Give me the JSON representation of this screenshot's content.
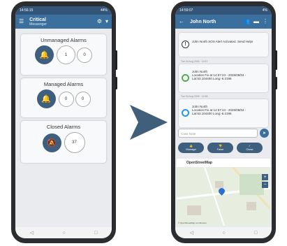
{
  "left_screen": {
    "status_time": "14:56:15",
    "status_battery": "44%",
    "title": "Critical",
    "subtitle": "Messenger",
    "cards": [
      {
        "title": "Unmanaged Alarms",
        "icon": "bell-ringing-icon",
        "counts": [
          "1",
          "0"
        ]
      },
      {
        "title": "Managed Alarms",
        "icon": "bell-icon",
        "counts": [
          "0",
          "0"
        ]
      },
      {
        "title": "Closed Alarms",
        "icon": "bell-off-icon",
        "counts": [
          "37"
        ]
      }
    ]
  },
  "right_screen": {
    "status_time": "14:59:07",
    "status_battery": "4%",
    "title": "John North",
    "messages": [
      {
        "text": "John North SOS Alert Activated. Send Help!",
        "timestamp": "",
        "icon": "alert-icon"
      },
      {
        "sender": "John North",
        "text": "Location Fix at 14:57:24 - 2026/08/04 - Lat:53.104400 Long:-6.2196",
        "timestamp": "Tue 04 Aug 2026 · 14:57",
        "icon": "location-pin-green-icon"
      },
      {
        "sender": "John North",
        "text": "Location Fix at 14:57:24 - 2026/08/04 - Lat:53.104400 Long:-6.2196",
        "timestamp": "Tue 04 Aug 2026 · 14:58",
        "icon": "location-pin-blue-icon"
      }
    ],
    "input_placeholder": "Case Note",
    "actions": [
      "Manage",
      "False",
      "Close"
    ],
    "map_title": "OpenStreetMap",
    "map_attribution": "© OpenStreetMap contributors"
  },
  "colors": {
    "appbar": "#3a6f9e",
    "statusbar": "#33557a",
    "icon_circle": "#3f5f7f",
    "arrow": "#3f5f7a"
  }
}
